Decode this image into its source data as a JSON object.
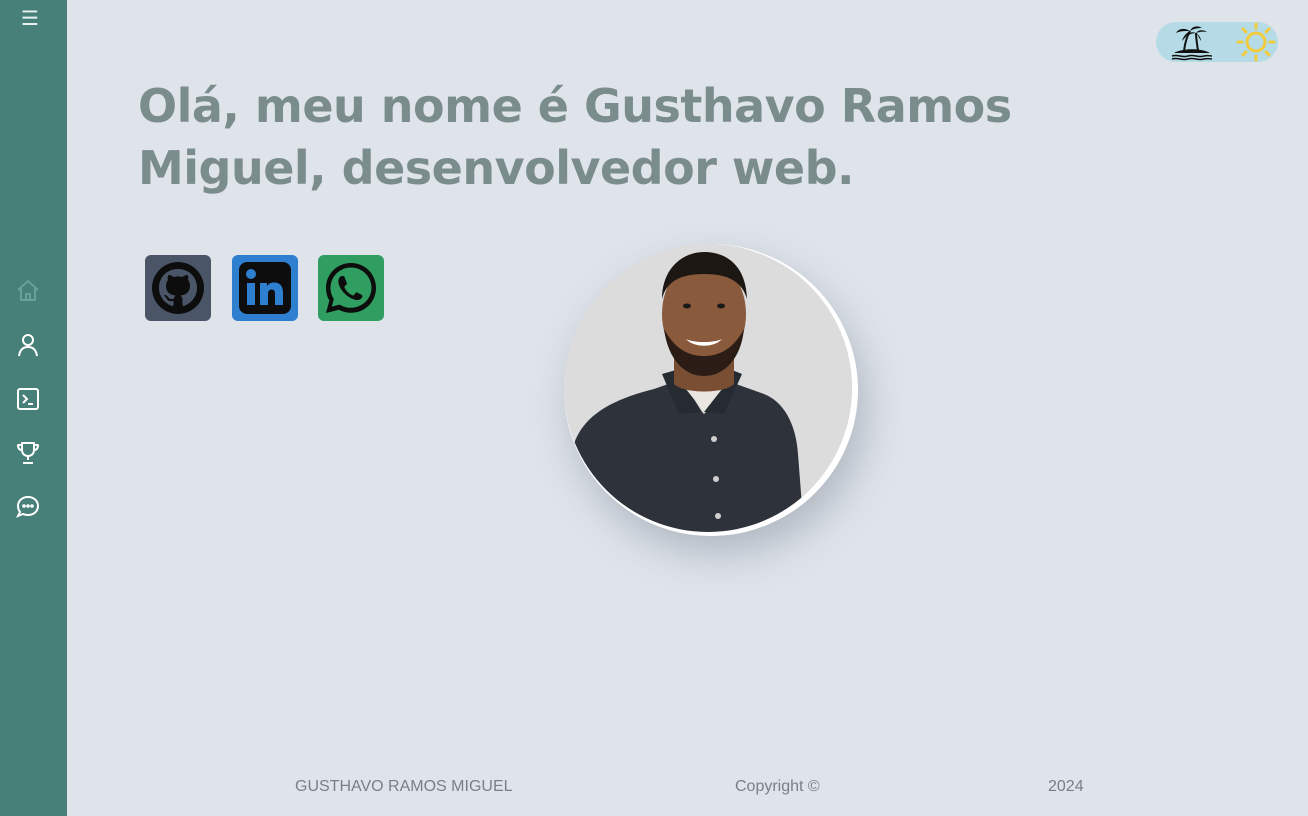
{
  "sidebar": {
    "menu_icon": "hamburger-icon",
    "items": [
      {
        "name": "home",
        "icon": "home-icon",
        "active": true
      },
      {
        "name": "about",
        "icon": "user-icon"
      },
      {
        "name": "projects",
        "icon": "terminal-icon"
      },
      {
        "name": "achievements",
        "icon": "trophy-icon"
      },
      {
        "name": "contact",
        "icon": "chat-icon"
      }
    ]
  },
  "hero": {
    "greeting": "Olá, meu nome é  Gusthavo Ramos Miguel, desenvolvedor web."
  },
  "social": [
    {
      "name": "github",
      "icon": "github-icon",
      "color": "#4a5568"
    },
    {
      "name": "linkedin",
      "icon": "linkedin-icon",
      "color": "#2f7fd1"
    },
    {
      "name": "whatsapp",
      "icon": "whatsapp-icon",
      "color": "#2f9e60"
    }
  ],
  "theme_toggle": {
    "left_icon": "island-icon",
    "right_icon": "sun-icon"
  },
  "footer": {
    "name": "GUSTHAVO RAMOS MIGUEL",
    "copyright": "Copyright ©",
    "year": "2024"
  },
  "colors": {
    "sidebar": "#468078",
    "background": "#dfe4eb",
    "heading": "#7a8c8c",
    "toggle": "#b5dbe6"
  }
}
